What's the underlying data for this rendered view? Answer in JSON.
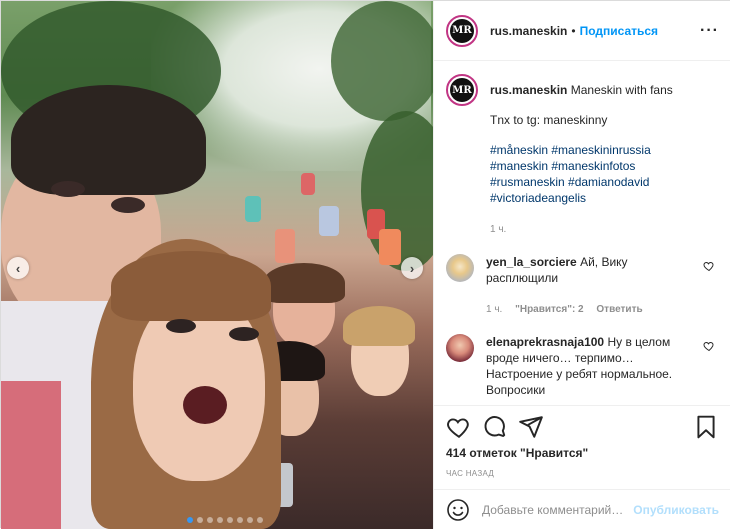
{
  "post": {
    "author": "rus.maneskin",
    "follow_label": "Подписаться",
    "avatar_text": "MR",
    "caption": "Maneskin with fans",
    "caption_line2": "Tnx to tg: maneskinny",
    "hashtags": [
      "#måneskin #maneskininrussia",
      "#maneskin #maneskinfotos",
      "#rusmaneskin #damianodavid",
      "#victoriadeangelis"
    ],
    "caption_time": "1 ч."
  },
  "comments": [
    {
      "user": "yen_la_sorciere",
      "text": "Ай, Вику расплющили",
      "time": "1 ч.",
      "likes": "\"Нравится\": 2",
      "reply": "Ответить"
    },
    {
      "user": "elenaprekrasnaja100",
      "text": "Ну в целом вроде ничего… терпимо… Настроение у ребят нормальное. Вопросики"
    }
  ],
  "stats": {
    "likes": "414 отметок \"Нравится\"",
    "time": "ЧАС НАЗАД"
  },
  "composer": {
    "placeholder": "Добавьте комментарий…",
    "post_label": "Опубликовать"
  },
  "carousel": {
    "slides": 8,
    "active_index": 0
  },
  "colors": {
    "link": "#0095f6",
    "hashtag": "#00376b",
    "muted": "#8e8e8e",
    "post_disabled": "#b2dffc"
  },
  "icons": [
    "more-options-icon",
    "heart-icon",
    "comment-icon",
    "share-icon",
    "bookmark-icon",
    "emoji-icon",
    "arrow-left-icon",
    "arrow-right-icon"
  ]
}
